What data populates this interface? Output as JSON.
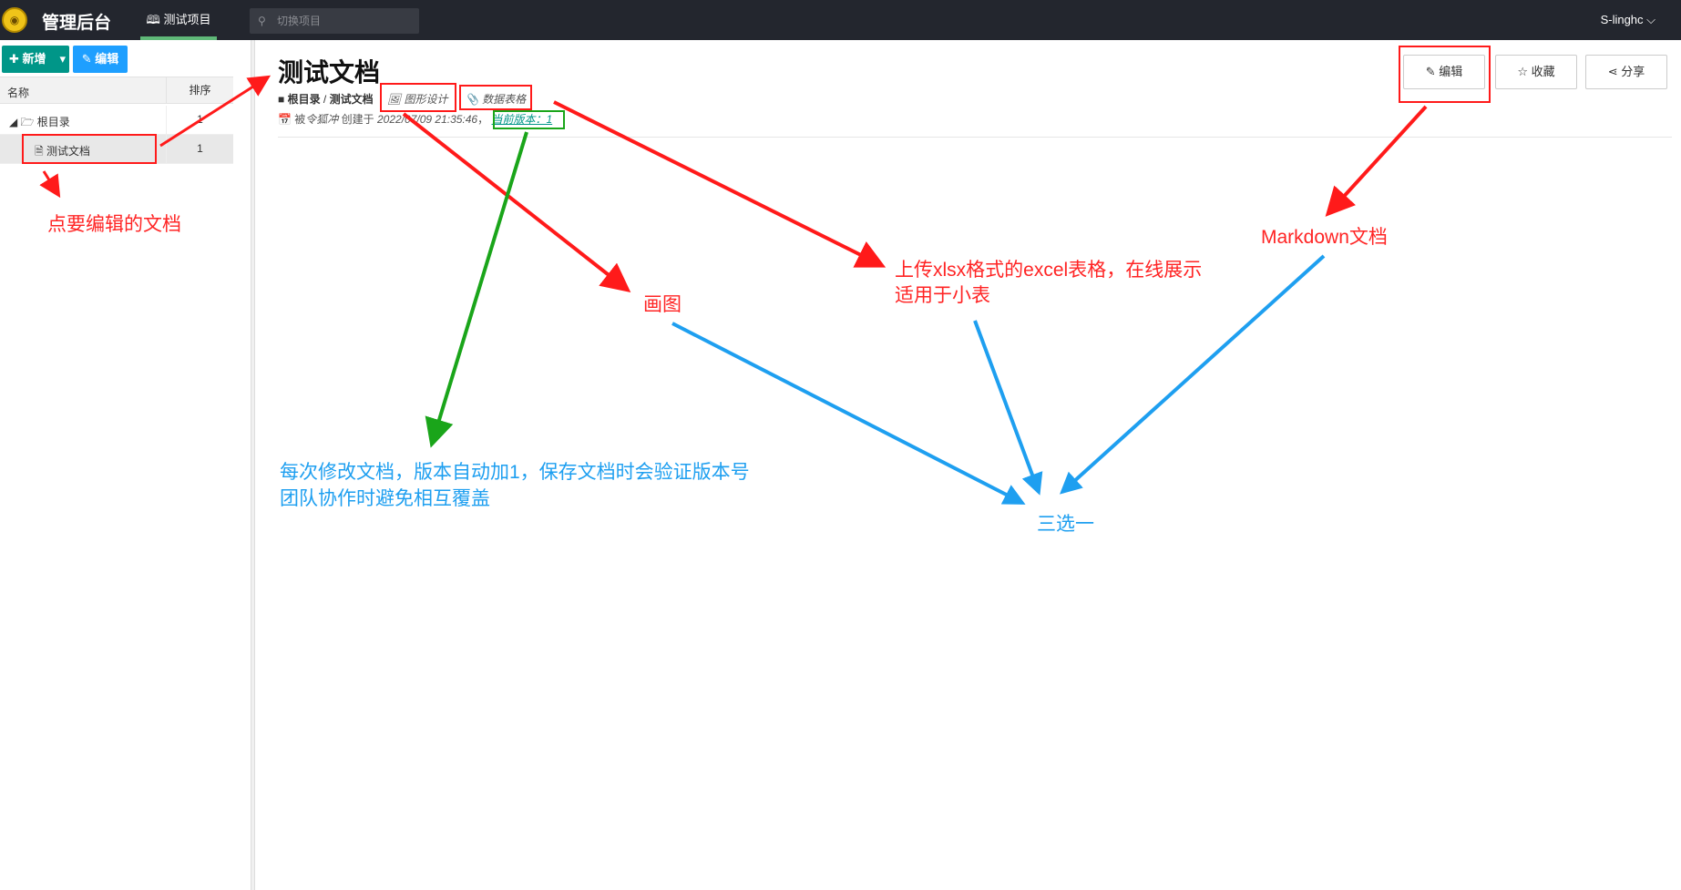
{
  "topbar": {
    "logo_glyph": "◉",
    "brand": "管理后台",
    "project_tab": "🕮 测试项目",
    "search_placeholder": "切换项目",
    "user": "S-linghc ⌵"
  },
  "sidebar": {
    "add_label": "✚ 新增",
    "add_caret": "▾",
    "edit_label": "✎ 编辑",
    "col_name": "名称",
    "col_order": "排序",
    "rows": [
      {
        "label": "◢ 🗁 根目录",
        "order": "1"
      },
      {
        "label": "🗎 测试文档",
        "order": "1"
      }
    ]
  },
  "doc": {
    "title": "测试文档",
    "crumb_root": "■ 根目录",
    "crumb_sep": " / ",
    "crumb_doc": "测试文档",
    "link_diagram": "🖼 图形设计",
    "link_table": "📎 数据表格",
    "meta_prefix": "📅 被",
    "author": "令狐冲",
    "created_label": "创建于",
    "created_at": "2022/07/09 21:35:46",
    "meta_sep": "，",
    "version": "当前版本：1"
  },
  "toolbar": {
    "edit": "✎ 编辑",
    "favorite": "☆ 收藏",
    "share": "⋖ 分享"
  },
  "annotations": {
    "doc_to_edit": "点要编辑的文档",
    "diagram": "画图",
    "excel_line1": "上传xlsx格式的excel表格，在线展示",
    "excel_line2": "适用于小表",
    "markdown": "Markdown文档",
    "version_line1": "每次修改文档，版本自动加1，保存文档时会验证版本号",
    "version_line2": "团队协作时避免相互覆盖",
    "choose_one": "三选一"
  },
  "colors": {
    "red": "#ff1a1a",
    "green": "#1aa51a",
    "blue": "#1e9ff0",
    "teal": "#009688"
  }
}
